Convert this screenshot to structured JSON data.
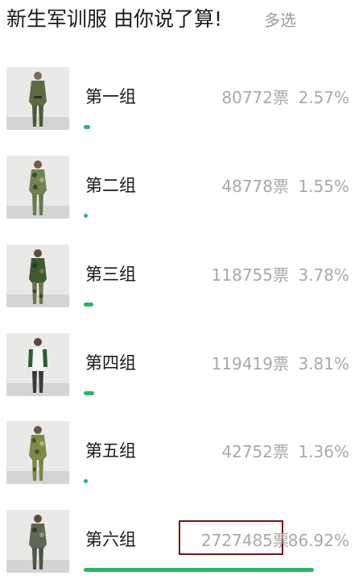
{
  "poll": {
    "title": "新生军训服 由你说了算!",
    "mode": "多选",
    "accent_color": "#2cb464",
    "highlight_color": "#7a1414",
    "options": [
      {
        "label": "第一组",
        "votes": "80772票",
        "percent": "2.57%",
        "share": 0.0257,
        "photo": "soldier-photo-olive-uniform"
      },
      {
        "label": "第二组",
        "votes": "48778票",
        "percent": "1.55%",
        "share": 0.0155,
        "photo": "soldier-photo-camo-uniform"
      },
      {
        "label": "第三组",
        "votes": "118755票",
        "percent": "3.78%",
        "share": 0.0378,
        "photo": "soldier-photo-green-camo-uniform"
      },
      {
        "label": "第四组",
        "votes": "119419票",
        "percent": "3.81%",
        "share": 0.0381,
        "photo": "soldier-photo-white-green-uniform"
      },
      {
        "label": "第五组",
        "votes": "42752票",
        "percent": "1.36%",
        "share": 0.0136,
        "photo": "soldier-photo-woodland-camo-uniform"
      },
      {
        "label": "第六组",
        "votes": "2727485票",
        "percent": "86.92%",
        "share": 0.8692,
        "photo": "soldier-photo-gray-camo-uniform"
      }
    ]
  }
}
